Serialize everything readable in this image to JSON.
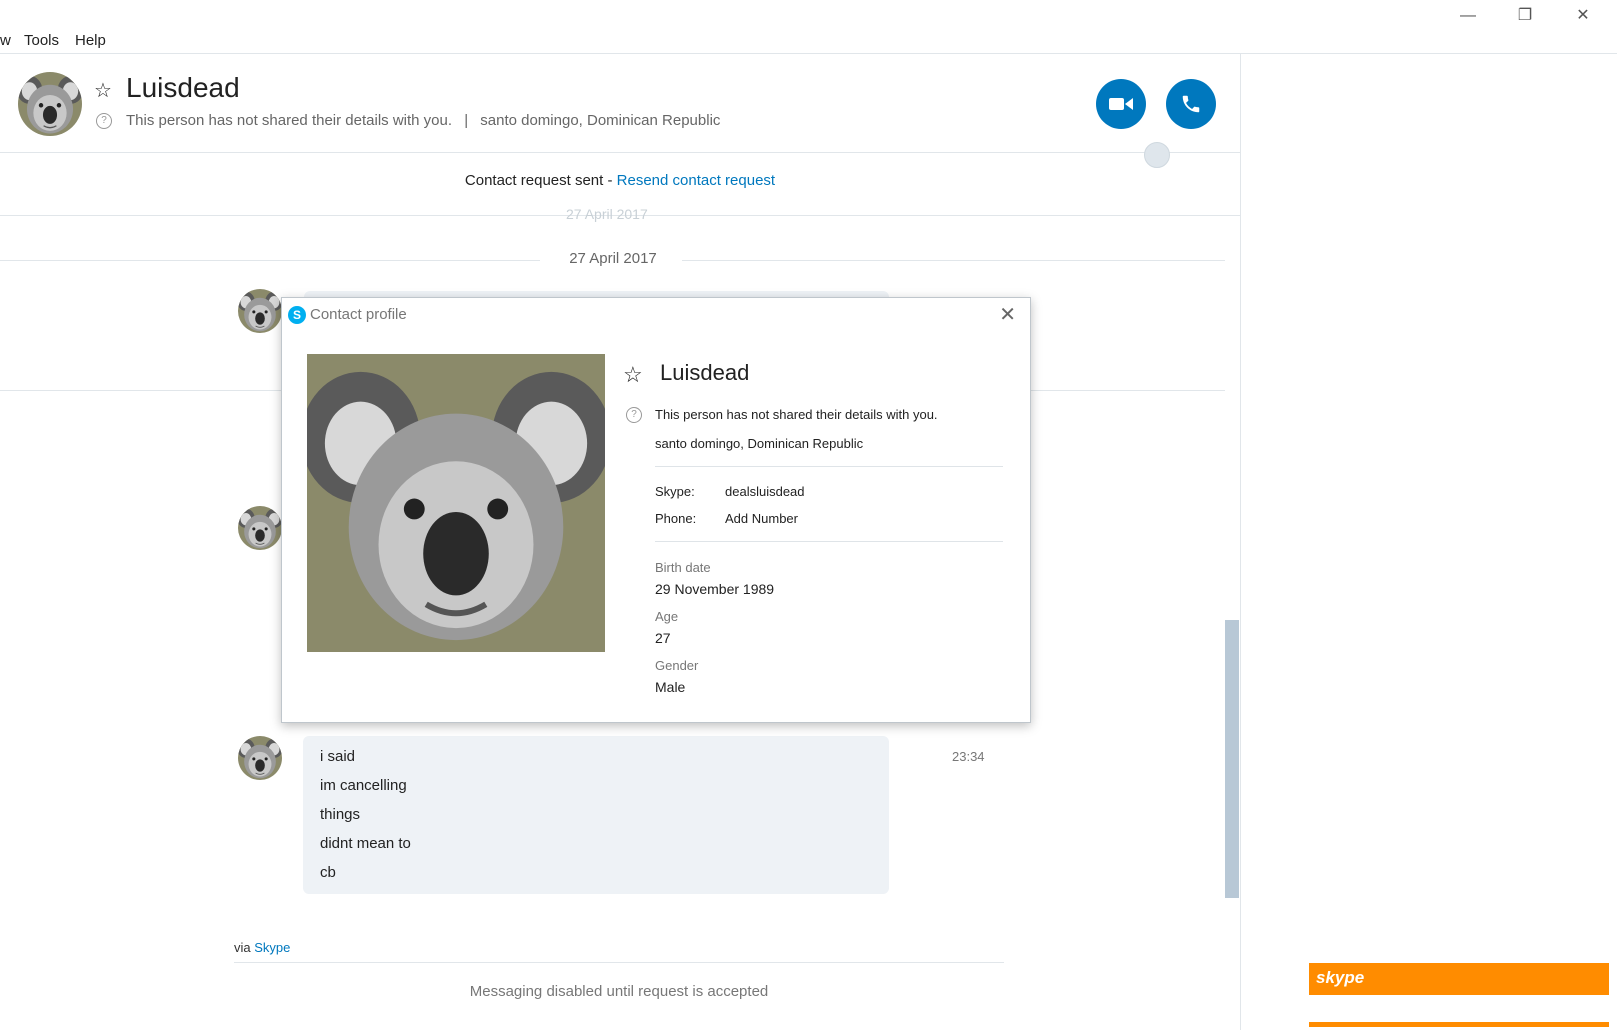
{
  "menu": [
    "w",
    "Tools",
    "Help"
  ],
  "window_controls": {
    "minimize": "—",
    "restore": "❐",
    "close": "✕"
  },
  "header": {
    "name": "Luisdead",
    "status": "This person has not shared their details with you.",
    "separator": "|",
    "location": "santo domingo, Dominican Republic"
  },
  "request": {
    "text": "Contact request sent - ",
    "link": "Resend contact request"
  },
  "chat": {
    "faded_date": "27 April 2017",
    "date": "27 April 2017",
    "messages": [
      "i said",
      "im cancelling",
      "things",
      "didnt mean to",
      "cb"
    ],
    "time": "23:34",
    "via_text": "via ",
    "via_link": "Skype",
    "disabled": "Messaging disabled until request is accepted"
  },
  "dialog": {
    "title": "Contact profile",
    "name": "Luisdead",
    "status": "This person has not shared their details with you.",
    "location": "santo domingo, Dominican Republic",
    "skype_label": "Skype:",
    "skype_value": "dealsluisdead",
    "phone_label": "Phone:",
    "phone_value": "Add Number",
    "birth_label": "Birth date",
    "birth_value": "29 November 1989",
    "age_label": "Age",
    "age_value": "27",
    "gender_label": "Gender",
    "gender_value": "Male"
  },
  "ad": {
    "logo": "skype"
  },
  "colors": {
    "accent": "#0078be",
    "ad": "#ff8c00",
    "bubble": "#eef2f6"
  }
}
